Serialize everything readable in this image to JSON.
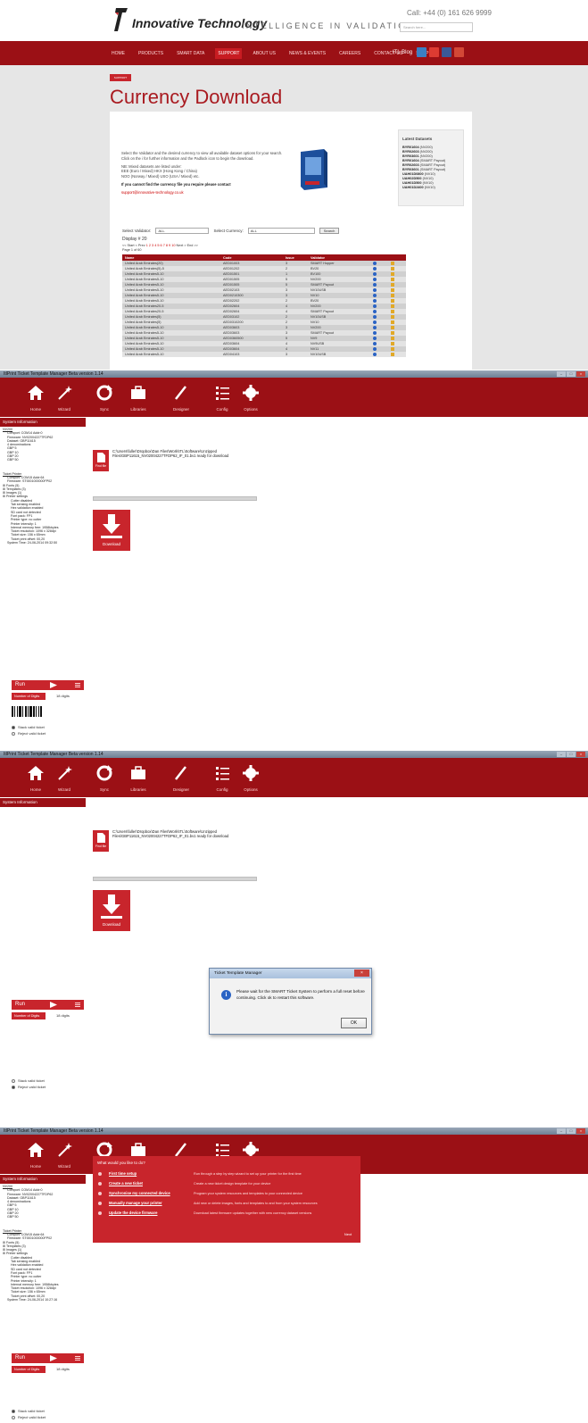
{
  "site": {
    "logo_text": "Innovative Technology",
    "tagline": "INTELLIGENCE IN VALIDATION",
    "call": "Call: +44 (0) 161 626 9999",
    "search_placeholder": "Search here...",
    "nav": [
      "HOME",
      "PRODUCTS",
      "SMART DATA",
      "SUPPORT",
      "ABOUT US",
      "NEWS & EVENTS",
      "CAREERS",
      "CONTACT US",
      "SHOP"
    ],
    "nav_active": 3,
    "social_blog": "ITL Blog",
    "breadcrumb": "SUPPORT",
    "page_title": "Currency Download",
    "intro_1": "Select the Validator and the desired currency to view all available dataset options for your search. Click on the i for further information and the Padlock icon to begin the download.",
    "intro_2": "NB: Mixed datasets are listed under:",
    "intro_3": "EEE (Euro / Mixed) HKX (Hong Kong / China)",
    "intro_4": "NOO (Norway / Mixed) USO (USA / Mixed) etc.",
    "intro_strong": "If you cannot find the currency file you require please contact",
    "intro_mail": "support@innovative-technology.co.uk",
    "latest_title": "Latest Datasets",
    "latest": [
      {
        "code": "BYR01604",
        "v": "(NV200)"
      },
      {
        "code": "BYR02603",
        "v": "(NV200)"
      },
      {
        "code": "BYR03601",
        "v": "(NV200)"
      },
      {
        "code": "BYR01604",
        "v": "(SMART Payout)"
      },
      {
        "code": "BYR02603",
        "v": "(SMART Payout)"
      },
      {
        "code": "BYR03601",
        "v": "(SMART Payout)"
      },
      {
        "code": "UAH01D0800",
        "v": "(NV10)"
      },
      {
        "code": "UAH02D500",
        "v": "(NV10)"
      },
      {
        "code": "UAH01D500",
        "v": "(NV10)"
      },
      {
        "code": "UAH01D2400",
        "v": "(NV10)"
      }
    ],
    "select_validator_label": "Select Validator:",
    "select_validator_value": "ALL",
    "select_currency_label": "Select Currency:",
    "select_currency_value": "ALL",
    "search_button": "Search",
    "display_label": "Display # 20",
    "pager_prefix": "<< Start < Prev",
    "pager_pages": "1 2 3 4 5 6 7 8 9 10",
    "pager_suffix": "Next > End >>",
    "page_of": "Page 1 of 60",
    "table_headers": [
      "Name",
      "Code",
      "Issue",
      "Validator"
    ],
    "table_rows": [
      [
        "United Arab Emirates(20)",
        "AED01003",
        "3",
        "SMART Hopper"
      ],
      [
        "United Arab Emirates(5)-5",
        "AED01202",
        "2",
        "BV20"
      ],
      [
        "United Arab Emirates5-10",
        "AED01501",
        "1",
        "BV100"
      ],
      [
        "United Arab Emirates5-10",
        "AED01505",
        "5",
        "NV200"
      ],
      [
        "United Arab Emirates5-10",
        "AED01505",
        "5",
        "SMART Payout"
      ],
      [
        "United Arab Emirates5-10",
        "AED02103",
        "3",
        "NV10USB"
      ],
      [
        "United Arab Emirates5-10",
        "AED0210300",
        "3",
        "NV10"
      ],
      [
        "United Arab Emirates5-10",
        "AED02202",
        "2",
        "BV20"
      ],
      [
        "United Arab Emirates20-5",
        "AED02604",
        "4",
        "NV200"
      ],
      [
        "United Arab Emirates20-5",
        "AED02604",
        "4",
        "SMART Payout"
      ],
      [
        "United Arab Emirates(5)",
        "AED03102",
        "2",
        "NV10USB"
      ],
      [
        "United Arab Emirates(5)",
        "AED0310200",
        "2",
        "NV10"
      ],
      [
        "United Arab Emirates5-10",
        "AED03603",
        "3",
        "NV200"
      ],
      [
        "United Arab Emirates5-10",
        "AED03603",
        "3",
        "SMART Payout"
      ],
      [
        "United Arab Emirates5-10",
        "AED0360500",
        "5",
        "NV9"
      ],
      [
        "United Arab Emirates5-10",
        "AED03604",
        "4",
        "NV9USB"
      ],
      [
        "United Arab Emirates5-10",
        "AED03604",
        "4",
        "NV11"
      ],
      [
        "United Arab Emirates5-10",
        "AED04103",
        "3",
        "NV10USB"
      ]
    ]
  },
  "app": {
    "window_title": "ItlPrint    Ticket Template Manager Beta version 1.14",
    "toolbar": [
      "Home",
      "Wizard",
      "Sync",
      "Libraries",
      "Designer",
      "Config",
      "Options"
    ],
    "side_header": "System Information",
    "validator_info": {
      "title": "NV200",
      "lines": [
        "Comport: COM14 Addr:0",
        "Firmware: NV02004227TFDP62",
        "Dataset: GBP11615",
        "4 denominations",
        "GBP 5",
        "GBP 10",
        "GBP 20",
        "GBP 50"
      ]
    },
    "printer_info": {
      "title": "Ticket Printer",
      "lines": [
        "Comport: COM15 Addr:64",
        "Firmware: ST0001000000FP02"
      ],
      "tree": [
        "Fonts (5)",
        "Templates (3)",
        "Images (1)",
        "Printer settings"
      ],
      "settings": [
        "Cutter disabled",
        "Tab sensing enabled",
        "Hex validation enabled",
        "SD card not detected",
        "Font pack: FP1",
        "Printer type: no cutter",
        "Printer intensity: 1",
        "Internal memory free: 1958kbytes",
        "Ticket resolution: 1096 x 328dpi",
        "Ticket size: 156 x 65mm",
        "Ticket print offset: 00,20"
      ],
      "system_time_1": "System Time: 24-06-2014 09:32:50",
      "system_time_3": "System Time: 24-06-2014 10:27:16"
    },
    "find_file": "Find file",
    "path": "C:\\Users\\fuller\\Dropbox\\Dan Files\\Work\\ITL\\Software\\Unzipped Files\\GBP11615_NV02004227TFDP62_IF_01.bv1 ready for download",
    "download": "Download",
    "run": "Run",
    "digits_label": "Number of Digits",
    "digits_value": "18 digits",
    "radio_stack": "Stack valid ticket",
    "radio_reject": "Reject valid ticket",
    "dialog": {
      "title": "Ticket Template Manager",
      "message": "Please wait for the SMART Ticket System to perform a full reset before continuing. Click ok to restart this software.",
      "ok": "OK"
    },
    "wizard": {
      "question": "What would you like to do?",
      "items": [
        {
          "title": "First time setup",
          "desc": "Run through a step by step wizard to set up your printer for the first time"
        },
        {
          "title": "Create a new ticket",
          "desc": "Create a new ticket design template for your device"
        },
        {
          "title": "Synchronise my connected device",
          "desc": "Program your system resources and templates to your connected device"
        },
        {
          "title": "Manually manage your printer",
          "desc": "Add new or delete images, fonts and templates to and from your system resources"
        },
        {
          "title": "Update the device firmware",
          "desc": "Download latest firmware updates together with new currency dataset versions"
        }
      ],
      "next": "Next"
    }
  },
  "colors": {
    "brand": "#9b1015",
    "accent": "#c8252c"
  }
}
